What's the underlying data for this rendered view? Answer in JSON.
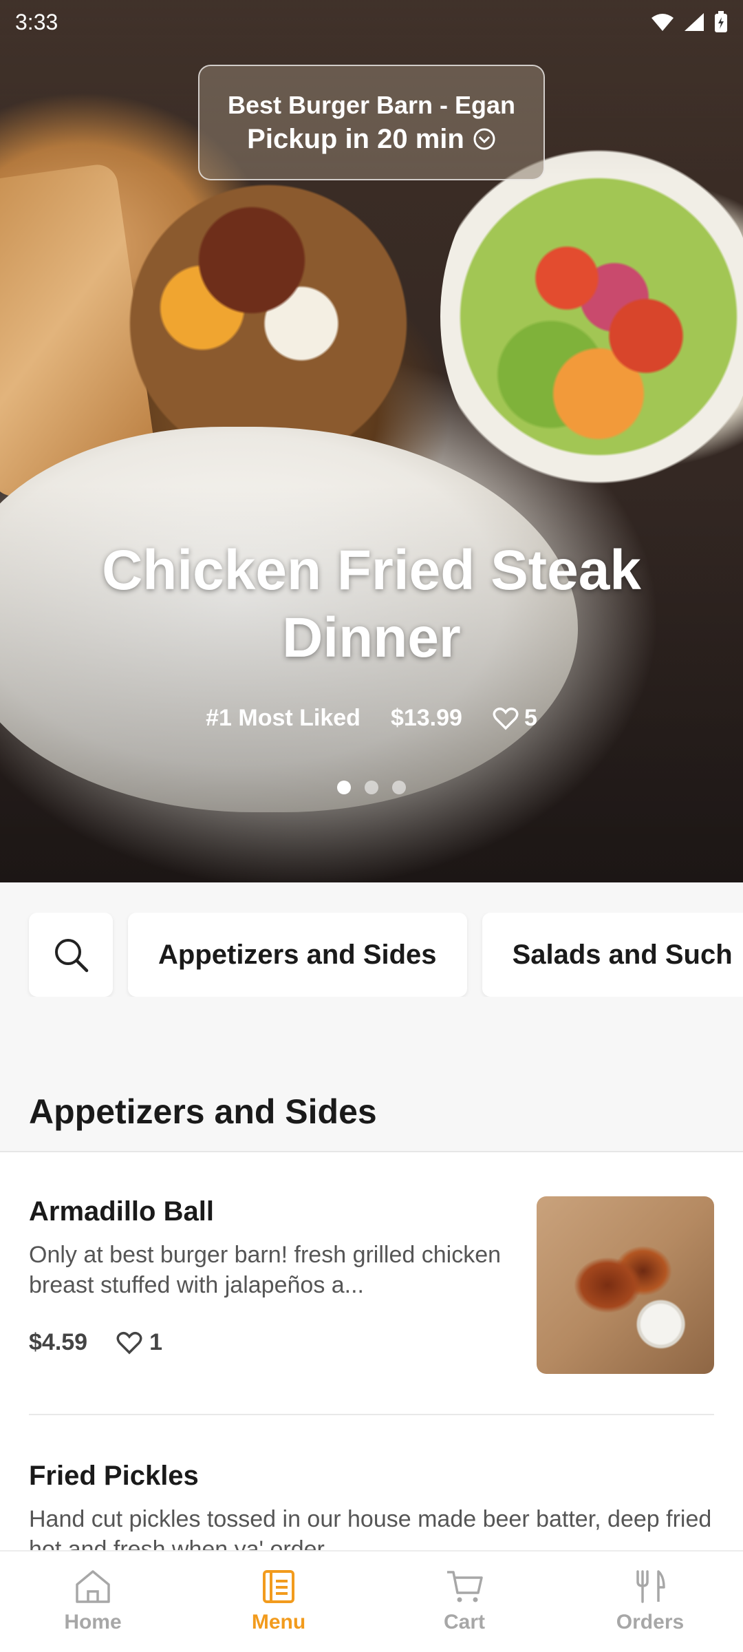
{
  "status_bar": {
    "time": "3:33"
  },
  "hero": {
    "store_name": "Best Burger Barn - Egan",
    "pickup": "Pickup in 20 min",
    "title": "Chicken Fried Steak Dinner",
    "rank": "#1 Most Liked",
    "price": "$13.99",
    "likes": "5",
    "carousel_index": 1,
    "carousel_total": 3
  },
  "categories": [
    "Appetizers and Sides",
    "Salads and Such"
  ],
  "section": {
    "title": "Appetizers and Sides"
  },
  "items": [
    {
      "name": "Armadillo Ball",
      "description": "Only at best burger barn! fresh grilled chicken breast stuffed with jalapeños a...",
      "price": "$4.59",
      "likes": "1"
    },
    {
      "name": "Fried Pickles",
      "description": "Hand cut pickles tossed in our house made beer batter, deep fried hot and fresh when ya' order"
    }
  ],
  "nav": {
    "home": "Home",
    "menu": "Menu",
    "cart": "Cart",
    "orders": "Orders",
    "active": "menu",
    "accent_color": "#f29b1d"
  }
}
